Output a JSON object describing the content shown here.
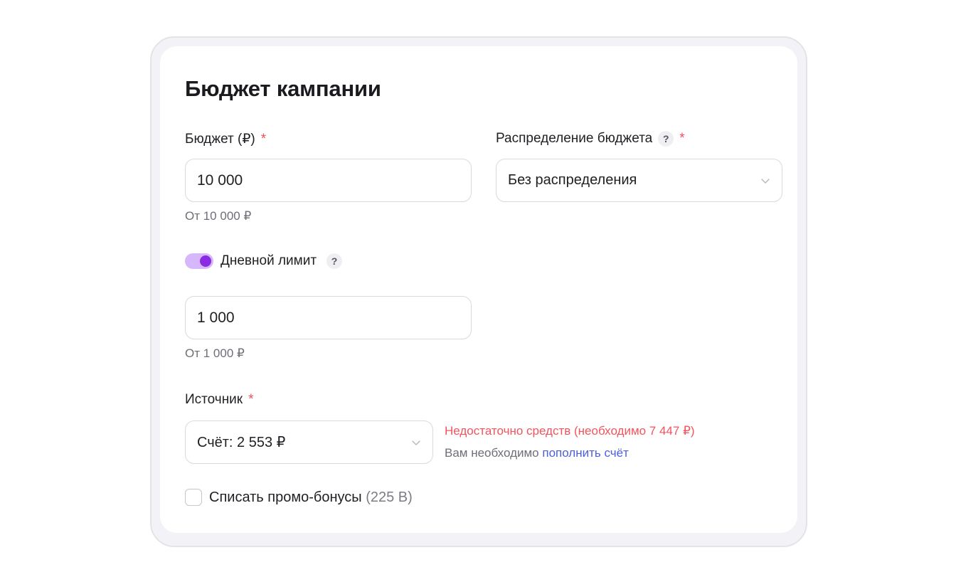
{
  "section": {
    "title": "Бюджет кампании"
  },
  "budget": {
    "label": "Бюджет (₽)",
    "required": "*",
    "value": "10 000",
    "hint": "От 10 000 ₽"
  },
  "distribution": {
    "label": "Распределение бюджета",
    "help": "?",
    "required": "*",
    "selected": "Без распределения"
  },
  "daily_limit": {
    "label": "Дневной лимит",
    "help": "?",
    "enabled": true,
    "value": "1 000",
    "hint": "От 1 000 ₽"
  },
  "source": {
    "label": "Источник",
    "required": "*",
    "selected": "Счёт: 2 553 ₽",
    "error": "Недостаточно средств (необходимо 7 447 ₽)",
    "info_prefix": "Вам необходимо",
    "info_link": "пополнить счёт"
  },
  "promo": {
    "label": "Списать промо-бонусы",
    "amount": "(225 В)",
    "checked": false
  },
  "colors": {
    "accent": "#8a2be2",
    "toggle_track": "#d7b7fb",
    "error": "#f0555d",
    "link": "#4a5fe0",
    "required": "#f0505a"
  },
  "icons": {
    "dropdown": "chevron-down-icon",
    "help": "question-icon"
  }
}
